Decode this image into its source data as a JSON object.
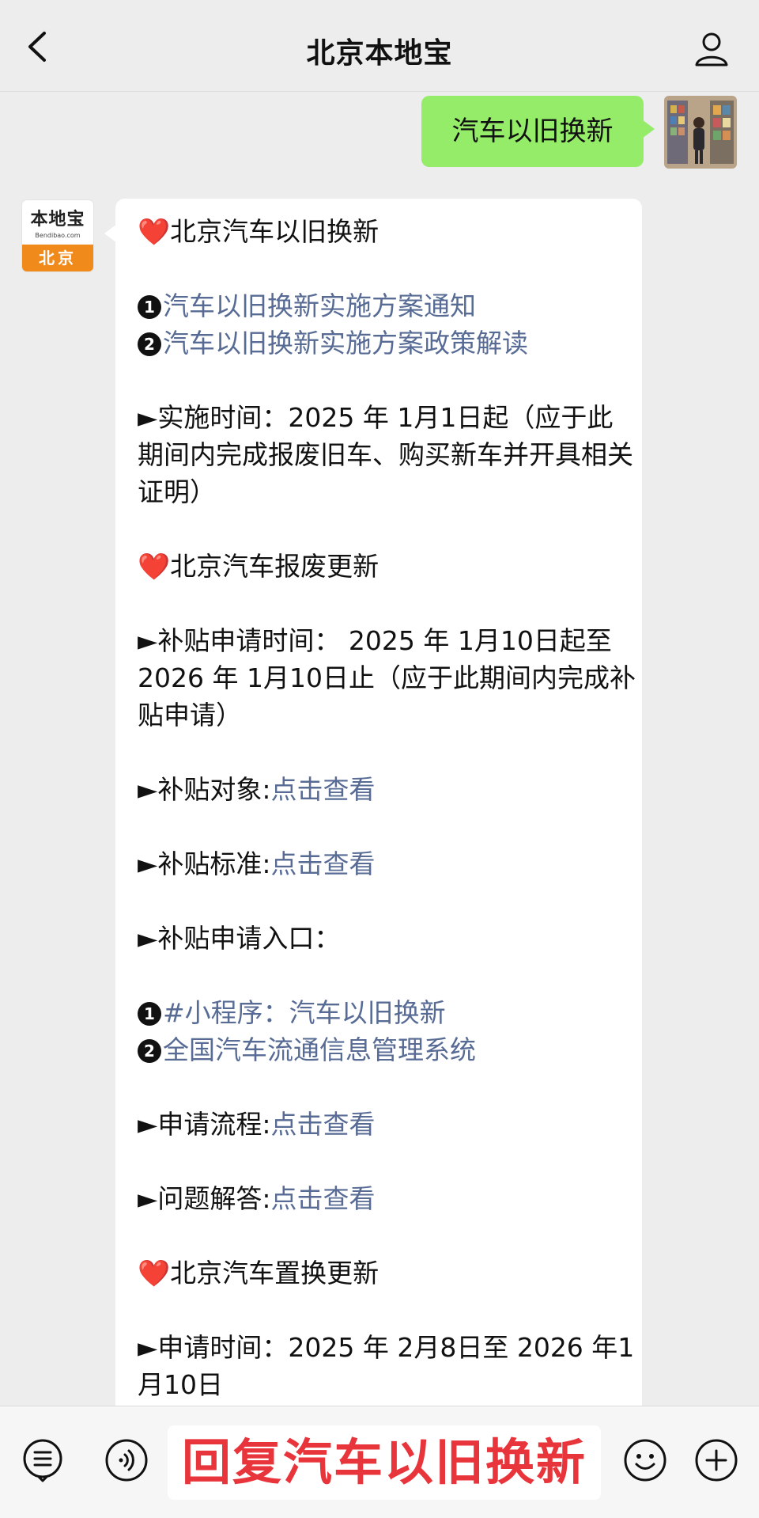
{
  "header": {
    "title": "北京本地宝",
    "back_icon": "chevron-left-icon",
    "profile_icon": "user-icon"
  },
  "me_message": {
    "text": "汽车以旧换新"
  },
  "bot_avatar": {
    "brand": "本地宝",
    "url": "Bendibao.com",
    "city": "北京"
  },
  "bot_message": {
    "s1_title": "北京汽车以旧换新",
    "s1_link1": "汽车以旧换新实施方案通知",
    "s1_link2": "汽车以旧换新实施方案政策解读",
    "s1_time_text": "►实施时间：2025 年 1月1日起（应于此期间内完成报废旧车、购买新车并开具相关证明）",
    "s2_title": "北京汽车报废更新",
    "s2_time_text": "►补贴申请时间： 2025 年 1月10日起至 2026 年 1月10日止（应于此期间内完成补贴申请）",
    "s2_target_label": "►补贴对象:",
    "s2_standard_label": "►补贴标准:",
    "s2_entry_label": "►补贴申请入口：",
    "s2_entry1": "#小程序：汽车以旧换新",
    "s2_entry2": "全国汽车流通信息管理系统",
    "s2_process_label": "►申请流程:",
    "s2_faq_label": "►问题解答:",
    "link_view": "点击查看",
    "s3_title": "北京汽车置换更新",
    "s3_time_text": "►申请时间：2025 年 2月8日至 2026 年1月10日"
  },
  "footer": {
    "promo_text": "回复汽车以旧换新",
    "menu_icon": "menu-list-icon",
    "voice_icon": "voice-icon",
    "emoji_icon": "emoji-icon",
    "plus_icon": "plus-icon"
  },
  "colors": {
    "link": "#576b95",
    "bubble_me": "#95ec69",
    "promo": "#e8343b",
    "logo_orange": "#f08a1a"
  }
}
